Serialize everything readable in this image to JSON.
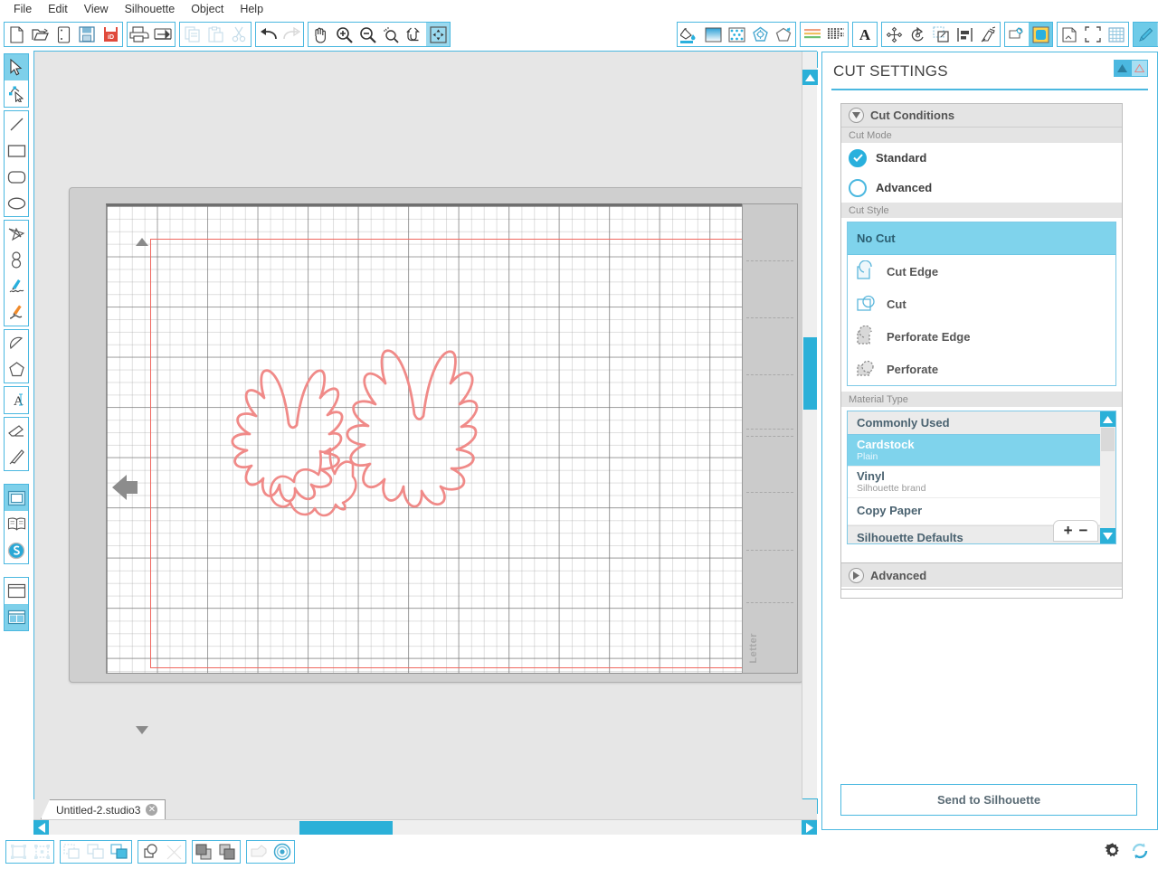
{
  "app": {
    "menu": [
      "File",
      "Edit",
      "View",
      "Silhouette",
      "Object",
      "Help"
    ]
  },
  "toolbar": {
    "groups": [
      {
        "name": "file",
        "items": [
          {
            "icon": "new-document-icon",
            "label": "New"
          },
          {
            "icon": "open-folder-icon",
            "label": "Open"
          },
          {
            "icon": "new-from-template-icon",
            "label": "New From Template"
          },
          {
            "icon": "save-icon",
            "label": "Save"
          },
          {
            "icon": "save-as-id-icon",
            "label": "Save As"
          }
        ]
      },
      {
        "name": "print",
        "items": [
          {
            "icon": "print-icon",
            "label": "Print"
          },
          {
            "icon": "send-to-silhouette-icon",
            "label": "Send to Silhouette"
          }
        ]
      },
      {
        "name": "clipboard",
        "items": [
          {
            "icon": "copy-icon",
            "label": "Copy"
          },
          {
            "icon": "paste-icon",
            "label": "Paste"
          },
          {
            "icon": "cut-scissors-icon",
            "label": "Cut"
          }
        ]
      },
      {
        "name": "history",
        "items": [
          {
            "icon": "undo-icon",
            "label": "Undo"
          },
          {
            "icon": "redo-icon",
            "label": "Redo"
          }
        ]
      },
      {
        "name": "view",
        "items": [
          {
            "icon": "pan-hand-icon",
            "label": "Pan"
          },
          {
            "icon": "zoom-in-icon",
            "label": "Zoom In"
          },
          {
            "icon": "zoom-out-icon",
            "label": "Zoom Out"
          },
          {
            "icon": "zoom-selection-icon",
            "label": "Zoom to Selection"
          },
          {
            "icon": "zoom-region-icon",
            "label": "Zoom Region"
          },
          {
            "icon": "fit-to-window-icon",
            "label": "Fit to Window"
          }
        ]
      },
      {
        "name": "fill-line",
        "items": [
          {
            "icon": "fill-color-icon",
            "label": "Fill Color"
          },
          {
            "icon": "fill-gradient-icon",
            "label": "Gradient Fill"
          },
          {
            "icon": "fill-pattern-icon",
            "label": "Pattern Fill"
          },
          {
            "icon": "line-color-icon",
            "label": "Line Color"
          },
          {
            "icon": "line-style-icon",
            "label": "Line Style"
          }
        ]
      },
      {
        "name": "text-style",
        "items": [
          {
            "icon": "sketch-pens-icon",
            "label": "Sketch Pens"
          },
          {
            "icon": "text-style-icon",
            "label": "Text Style"
          }
        ]
      },
      {
        "name": "text",
        "items": [
          {
            "icon": "text-tool-icon",
            "label": "Text"
          }
        ]
      },
      {
        "name": "transform",
        "items": [
          {
            "icon": "transform-move-icon",
            "label": "Transform"
          },
          {
            "icon": "rotate-icon",
            "label": "Rotate"
          },
          {
            "icon": "scale-icon",
            "label": "Scale"
          },
          {
            "icon": "align-icon",
            "label": "Align"
          },
          {
            "icon": "modify-icon",
            "label": "Modify"
          }
        ]
      },
      {
        "name": "offset-trace",
        "items": [
          {
            "icon": "offset-icon",
            "label": "Offset"
          },
          {
            "icon": "trace-icon",
            "label": "Trace"
          }
        ]
      },
      {
        "name": "page",
        "items": [
          {
            "icon": "page-setup-icon",
            "label": "Page Setup"
          },
          {
            "icon": "registration-marks-icon",
            "label": "Registration Marks"
          },
          {
            "icon": "grid-icon",
            "label": "Grid"
          }
        ]
      },
      {
        "name": "cut",
        "items": [
          {
            "icon": "cut-settings-icon",
            "label": "Cut Settings",
            "active": true
          },
          {
            "icon": "send-icon",
            "label": "Send"
          }
        ]
      }
    ]
  },
  "lefttools": {
    "groups": [
      {
        "name": "selection",
        "items": [
          {
            "icon": "select-arrow-icon",
            "label": "Select",
            "active": true
          },
          {
            "icon": "edit-points-icon",
            "label": "Edit Points"
          }
        ]
      },
      {
        "name": "shapes",
        "items": [
          {
            "icon": "line-tool-icon",
            "label": "Draw a Line"
          },
          {
            "icon": "rectangle-tool-icon",
            "label": "Draw a Rectangle"
          },
          {
            "icon": "rounded-rectangle-tool-icon",
            "label": "Draw a Rounded Rectangle"
          },
          {
            "icon": "ellipse-tool-icon",
            "label": "Draw an Ellipse"
          }
        ]
      },
      {
        "name": "draw",
        "items": [
          {
            "icon": "polygon-tool-icon",
            "label": "Draw a Polygon"
          },
          {
            "icon": "curve-tool-icon",
            "label": "Draw a Curve Shape"
          },
          {
            "icon": "freehand-tool-icon",
            "label": "Draw Freehand"
          },
          {
            "icon": "smooth-freehand-tool-icon",
            "label": "Draw Smooth Freehand"
          }
        ]
      },
      {
        "name": "arc",
        "items": [
          {
            "icon": "arc-tool-icon",
            "label": "Draw an Arc"
          },
          {
            "icon": "regular-polygon-tool-icon",
            "label": "Draw a Regular Polygon"
          }
        ]
      },
      {
        "name": "text",
        "items": [
          {
            "icon": "text-tool-icon",
            "label": "Text Tool"
          }
        ]
      },
      {
        "name": "erase",
        "items": [
          {
            "icon": "eraser-tool-icon",
            "label": "Eraser"
          },
          {
            "icon": "knife-tool-icon",
            "label": "Knife"
          }
        ]
      },
      {
        "name": "panels",
        "items": [
          {
            "icon": "design-page-icon",
            "label": "Design Page",
            "active": true
          },
          {
            "icon": "library-book-icon",
            "label": "Library"
          },
          {
            "icon": "silhouette-store-icon",
            "label": "Store"
          }
        ]
      },
      {
        "name": "layout",
        "items": [
          {
            "icon": "single-view-icon",
            "label": "Single View"
          },
          {
            "icon": "split-view-icon",
            "label": "Split View",
            "active": true
          }
        ]
      }
    ]
  },
  "canvas": {
    "mat_label": "Letter",
    "shapes": [
      {
        "name": "butterfly-left",
        "stroke": "#f08a88"
      },
      {
        "name": "butterfly-right",
        "stroke": "#f08a88"
      }
    ],
    "page_outline_color": "#f0675f",
    "panel_expand_label": "»"
  },
  "document": {
    "tab_name": "Untitled-2.studio3",
    "close_label": "✕"
  },
  "cut_settings": {
    "title": "CUT SETTINGS",
    "cut_conditions": {
      "header": "Cut Conditions",
      "cut_mode": {
        "label": "Cut Mode",
        "options": [
          {
            "label": "Standard",
            "selected": true
          },
          {
            "label": "Advanced",
            "selected": false
          }
        ]
      },
      "cut_style": {
        "label": "Cut Style",
        "selected": "No Cut",
        "options": [
          {
            "label": "No Cut",
            "icon": "no-cut-icon",
            "selected": true
          },
          {
            "label": "Cut Edge",
            "icon": "cut-edge-icon",
            "selected": false
          },
          {
            "label": "Cut",
            "icon": "cut-icon",
            "selected": false
          },
          {
            "label": "Perforate Edge",
            "icon": "perforate-edge-icon",
            "selected": false
          },
          {
            "label": "Perforate",
            "icon": "perforate-icon",
            "selected": false
          }
        ]
      },
      "material_type": {
        "label": "Material Type",
        "groups": [
          {
            "label": "Commonly Used",
            "is_group": true
          },
          {
            "label": "Cardstock",
            "sub": "Plain",
            "selected": true
          },
          {
            "label": "Vinyl",
            "sub": "Silhouette brand",
            "selected": false
          },
          {
            "label": "Copy Paper",
            "sub": "",
            "selected": false
          },
          {
            "label": "Silhouette Defaults",
            "is_group": true
          }
        ],
        "add_label": "+",
        "remove_label": "−"
      }
    },
    "advanced": {
      "header": "Advanced"
    },
    "send_button": "Send to Silhouette"
  },
  "bottombar": {
    "groups": [
      {
        "name": "group",
        "items": [
          {
            "icon": "group-icon",
            "label": "Group"
          },
          {
            "icon": "ungroup-icon",
            "label": "Ungroup"
          }
        ]
      },
      {
        "name": "compound",
        "items": [
          {
            "icon": "make-compound-path-icon",
            "label": "Make Compound Path"
          },
          {
            "icon": "release-compound-path-icon",
            "label": "Release Compound Path"
          },
          {
            "icon": "weld-icon",
            "label": "Weld"
          }
        ]
      },
      {
        "name": "modify",
        "items": [
          {
            "icon": "merge-icon",
            "label": "Merge"
          },
          {
            "icon": "detach-icon",
            "label": "Detach Lines"
          }
        ]
      },
      {
        "name": "arrange",
        "items": [
          {
            "icon": "bring-to-front-icon",
            "label": "Bring to Front"
          },
          {
            "icon": "send-to-back-icon",
            "label": "Send to Back"
          }
        ]
      },
      {
        "name": "offset",
        "items": [
          {
            "icon": "offset-shape-icon",
            "label": "Offset"
          },
          {
            "icon": "internal-offset-icon",
            "label": "Internal Offset"
          }
        ]
      }
    ],
    "right_items": [
      {
        "icon": "preferences-gear-icon",
        "label": "Preferences"
      },
      {
        "icon": "sync-refresh-icon",
        "label": "Sync"
      }
    ]
  }
}
